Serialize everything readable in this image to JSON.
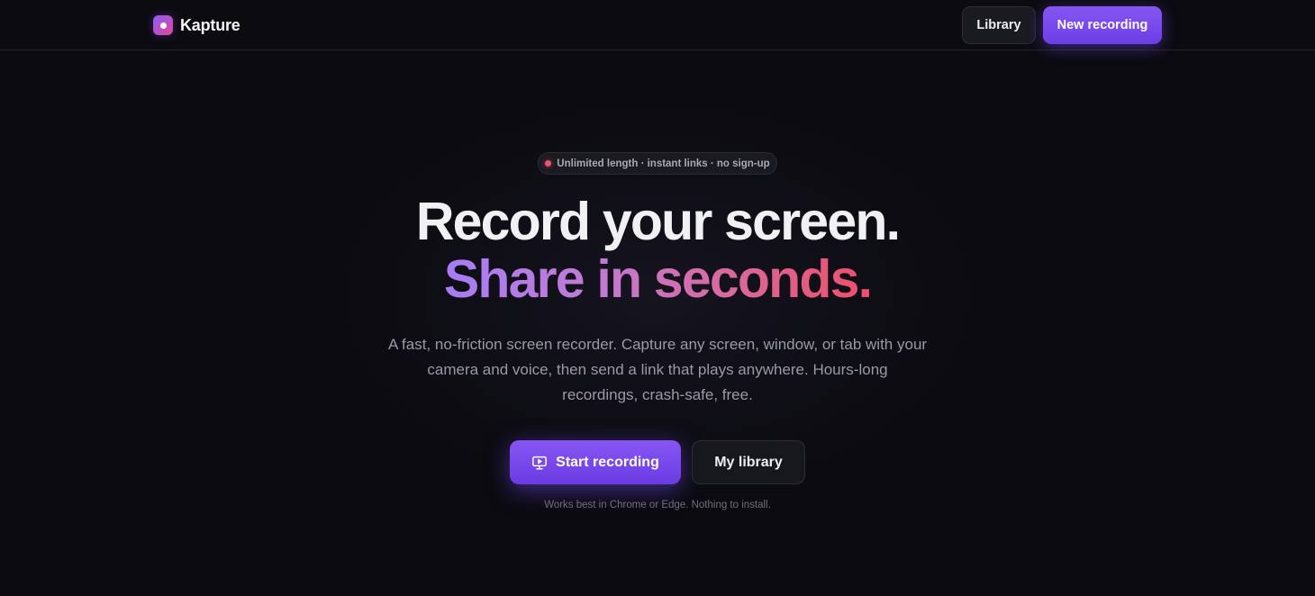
{
  "brand": {
    "name": "Kapture",
    "logo_icon": "record-dot-icon",
    "accent_gradient": [
      "#8b5cf6",
      "#e0479e"
    ]
  },
  "nav": {
    "library_label": "Library",
    "new_recording_label": "New recording"
  },
  "hero": {
    "badge_text": "Unlimited length · instant links · no sign-up",
    "badge_dot_color": "#f0506e",
    "headline_line1": "Record your screen.",
    "headline_line2": "Share in seconds.",
    "description": "A fast, no-friction screen recorder. Capture any screen, window, or tab with your camera and voice, then send a link that plays anywhere. Hours-long recordings, crash-safe, free.",
    "primary_cta": {
      "label": "Start recording",
      "icon": "screen-share-icon"
    },
    "secondary_cta": {
      "label": "My library"
    },
    "note": "Works best in Chrome or Edge. Nothing to install."
  },
  "colors": {
    "background": "#0b0b10",
    "primary": "#7c4dff",
    "headline_gradient": [
      "#a77cf5",
      "#ee4f6a"
    ]
  }
}
